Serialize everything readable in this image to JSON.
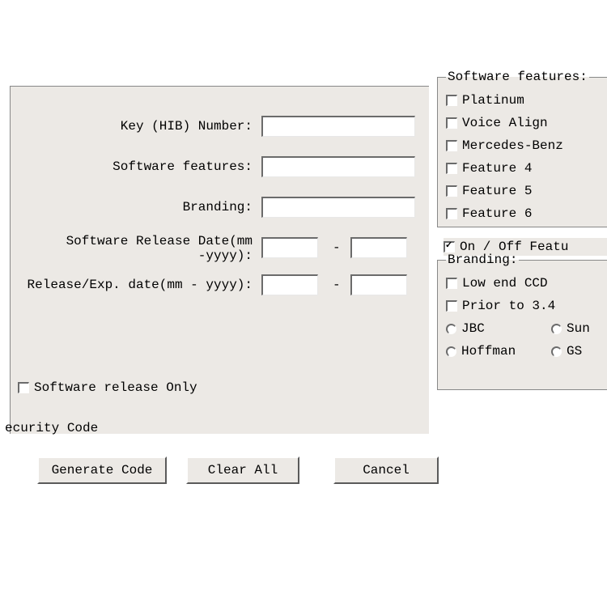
{
  "form": {
    "key_label": "Key (HIB) Number:",
    "features_label": "Software features:",
    "branding_label": "Branding:",
    "release_date_label_line1": "Software Release Date(mm",
    "release_date_label_line2": "-yyyy):",
    "exp_date_label": "Release/Exp. date(mm - yyyy):",
    "dash": "-",
    "key_value": "",
    "features_value": "",
    "branding_value": "",
    "rel_mm": "",
    "rel_yy": "",
    "exp_mm": "",
    "exp_yy": ""
  },
  "software_release_only": {
    "label": "Software release Only",
    "checked": false
  },
  "security_code_label": "ecurity Code",
  "buttons": {
    "generate": "Generate Code",
    "clear": "Clear All",
    "cancel": "Cancel"
  },
  "features_group": {
    "legend": "Software features:",
    "items": [
      {
        "label": "Platinum",
        "checked": false
      },
      {
        "label": "Voice Align",
        "checked": false
      },
      {
        "label": "Mercedes-Benz",
        "checked": false
      },
      {
        "label": "Feature 4",
        "checked": false
      },
      {
        "label": "Feature 5",
        "checked": false
      },
      {
        "label": "Feature 6",
        "checked": false
      }
    ]
  },
  "onoff": {
    "label": "On / Off Featu",
    "checked": true
  },
  "branding_group": {
    "legend": "Branding:",
    "checks": [
      {
        "label": "Low end CCD",
        "checked": false
      },
      {
        "label": "Prior to 3.4",
        "checked": false
      }
    ],
    "radios_left": [
      {
        "label": "JBC"
      },
      {
        "label": "Hoffman"
      }
    ],
    "radios_right": [
      {
        "label": "Sun"
      },
      {
        "label": "GS"
      }
    ]
  }
}
